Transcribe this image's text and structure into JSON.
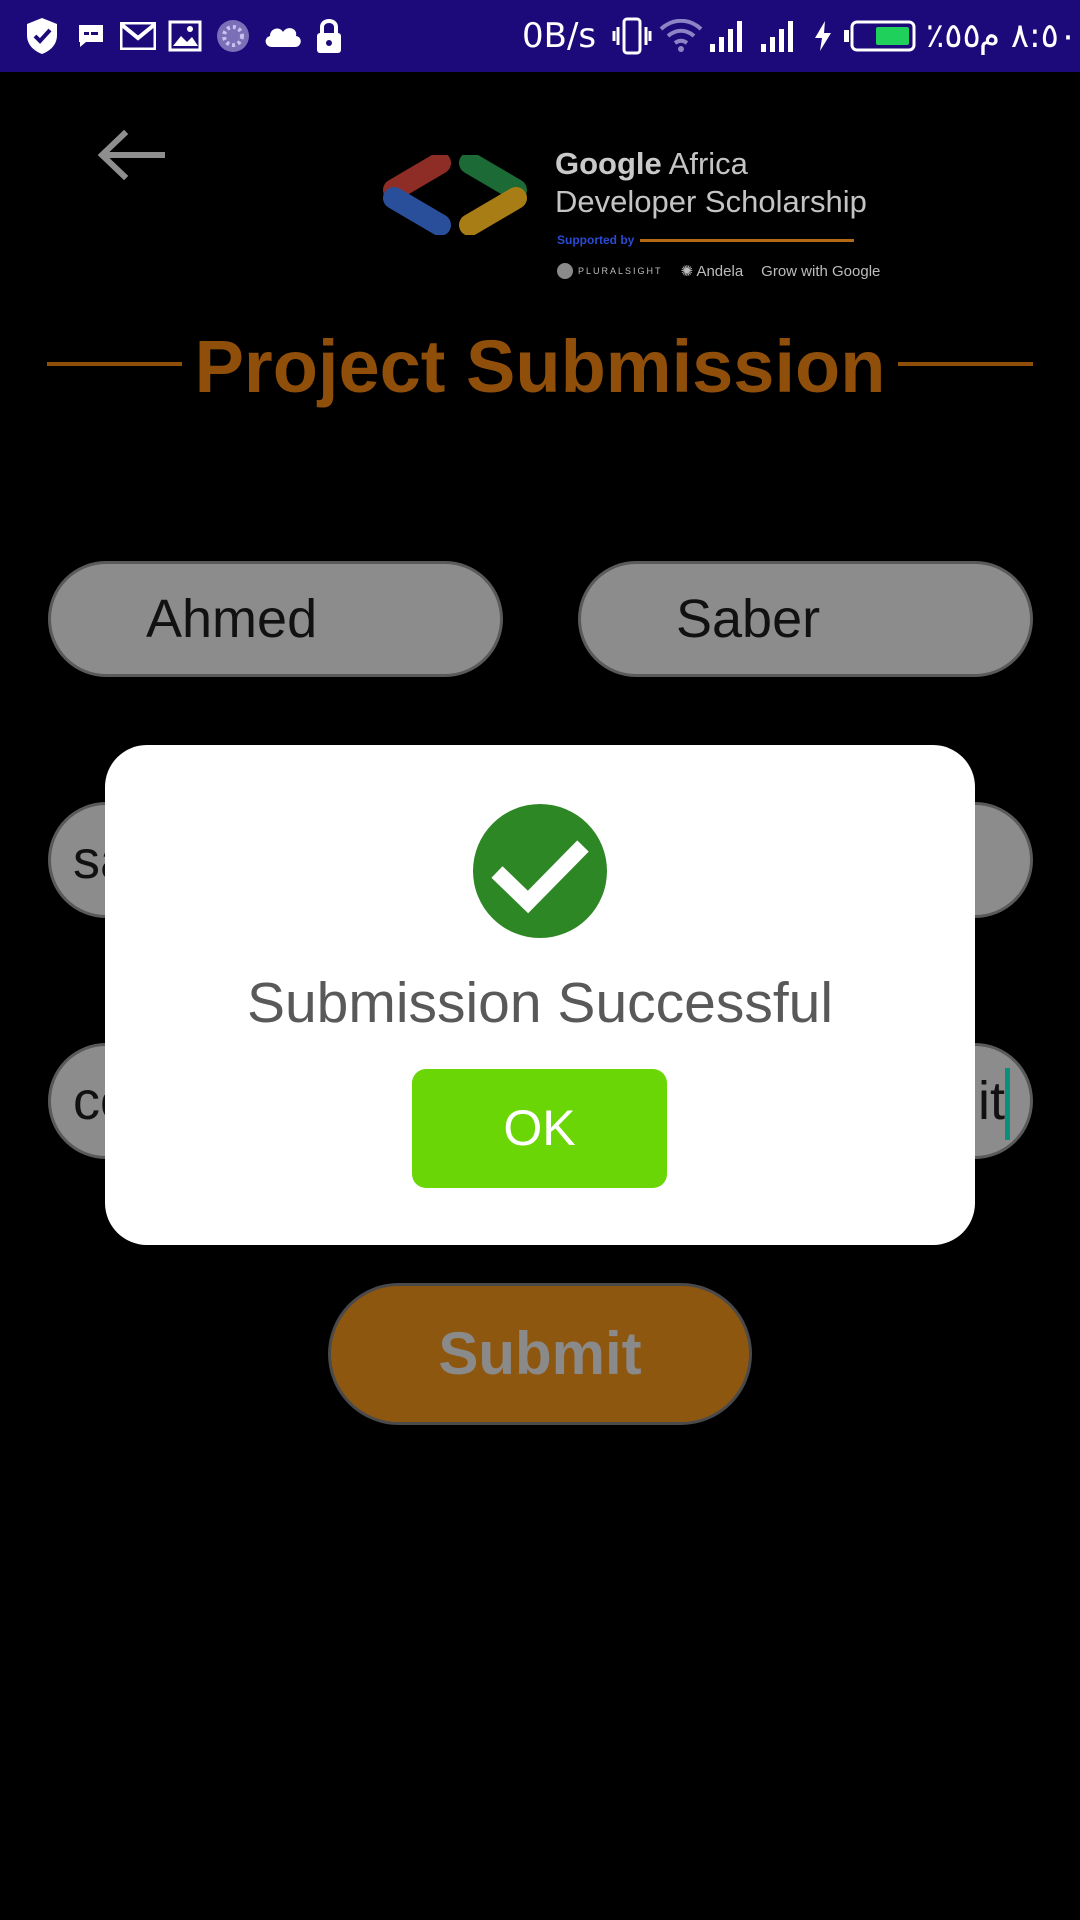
{
  "status_bar": {
    "network_speed": "0B/s",
    "battery": "٪٥٥",
    "time": "٨:٥٠ م",
    "icons": [
      "shield-icon",
      "message-icon",
      "gmail-icon",
      "gallery-icon",
      "loading-icon",
      "cloud-icon",
      "lock-icon",
      "vibrate-icon",
      "wifi-icon",
      "signal-icon",
      "signal-icon",
      "charging-icon",
      "battery-icon"
    ]
  },
  "header": {
    "back_icon": "arrow-left-icon",
    "logo": {
      "brand": "Google",
      "line1_rest": " Africa",
      "line2": "Developer Scholarship",
      "supported_by": "Supported by",
      "sponsors": [
        "PLURALSIGHT",
        "Andela",
        "Grow with Google"
      ]
    }
  },
  "title": "Project Submission",
  "form": {
    "first_name": "Ahmed",
    "last_name": "Saber",
    "email_partial": "sa",
    "link_partial_left": "co",
    "link_partial_right": "it",
    "submit_label": "Submit"
  },
  "dialog": {
    "icon": "check-circle-icon",
    "message": "Submission Successful",
    "ok_label": "OK"
  },
  "colors": {
    "status_bar": "#1d0a7a",
    "title": "#8f4f0a",
    "success": "#2e8725",
    "ok_button": "#6bd606",
    "submit": "#8e5710"
  }
}
